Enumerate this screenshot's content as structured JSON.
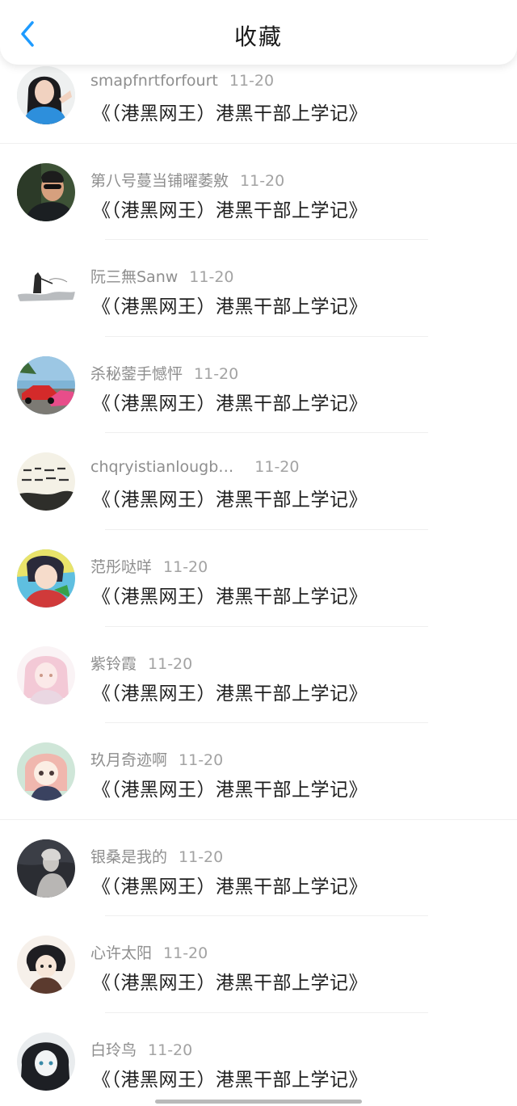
{
  "header": {
    "title": "收藏"
  },
  "items": [
    {
      "user": "smapfnrtforfourt",
      "time": "11-20",
      "work": "《（港黑网王）港黑干部上学记》",
      "avatar_icon": "avatar-girl-photo-icon"
    },
    {
      "user": "第八号蔓当铺曜萎敫",
      "time": "11-20",
      "work": "《（港黑网王）港黑干部上学记》",
      "avatar_icon": "avatar-man-sunglasses-icon"
    },
    {
      "user": "阮三無Sanw",
      "time": "11-20",
      "work": "《（港黑网王）港黑干部上学记》",
      "avatar_icon": "avatar-ink-figure-icon"
    },
    {
      "user": "杀秘蓥手憾怦",
      "time": "11-20",
      "work": "《（港黑网王）港黑干部上学记》",
      "avatar_icon": "avatar-red-cars-icon"
    },
    {
      "user": "chqryistianlougb…",
      "time": "11-20",
      "work": "《（港黑网王）港黑干部上学记》",
      "avatar_icon": "avatar-calligraphy-icon"
    },
    {
      "user": "范彤哒咩",
      "time": "11-20",
      "work": "《（港黑网王）港黑干部上学记》",
      "avatar_icon": "avatar-anime-colorful-icon"
    },
    {
      "user": "紫铃霞",
      "time": "11-20",
      "work": "《（港黑网王）港黑干部上学记》",
      "avatar_icon": "avatar-anime-pink-icon"
    },
    {
      "user": "玖月奇迹啊",
      "time": "11-20",
      "work": "《（港黑网王）港黑干部上学记》",
      "avatar_icon": "avatar-anime-girl-icon"
    },
    {
      "user": "银桑是我的",
      "time": "11-20",
      "work": "《（港黑网王）港黑干部上学记》",
      "avatar_icon": "avatar-dark-figure-icon"
    },
    {
      "user": "心许太阳",
      "time": "11-20",
      "work": "《（港黑网王）港黑干部上学记》",
      "avatar_icon": "avatar-anime-boy-icon"
    },
    {
      "user": "白玲鸟",
      "time": "11-20",
      "work": "《（港黑网王）港黑干部上学记》",
      "avatar_icon": "avatar-anime-sketch-icon"
    }
  ],
  "colors": {
    "accent": "#1e9bff",
    "muted": "#8e8e8e",
    "text": "#1f1f1f"
  }
}
